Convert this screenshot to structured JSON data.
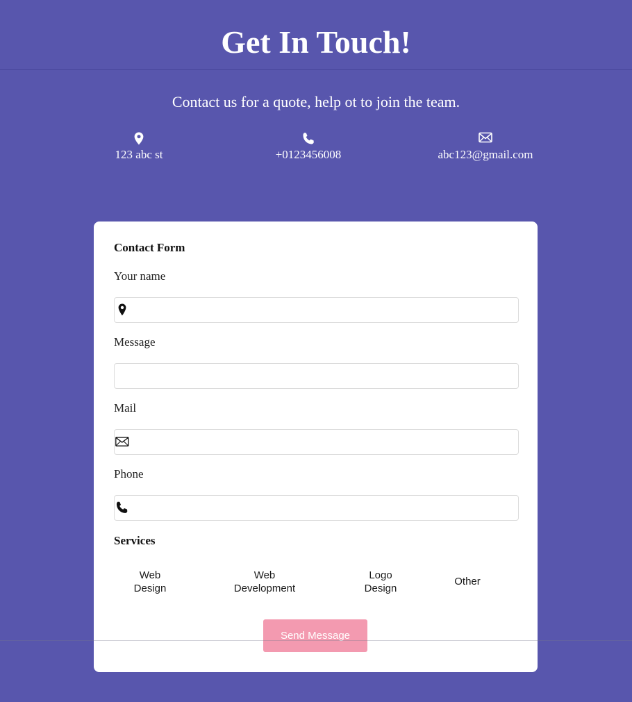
{
  "header": {
    "title": "Get In Touch!",
    "subtitle": "Contact us for a quote, help ot to join the team."
  },
  "contact_info": {
    "address": {
      "icon": "map-pin-icon",
      "text": "123 abc st"
    },
    "phone": {
      "icon": "phone-icon",
      "text": "+0123456008"
    },
    "email": {
      "icon": "envelope-icon",
      "text": "abc123@gmail.com"
    }
  },
  "form": {
    "heading": "Contact Form",
    "fields": {
      "name": {
        "label": "Your name",
        "value": "",
        "placeholder": "",
        "icon": "map-pin-icon"
      },
      "message": {
        "label": "Message",
        "value": "",
        "placeholder": ""
      },
      "mail": {
        "label": "Mail",
        "value": "",
        "placeholder": "",
        "icon": "envelope-icon"
      },
      "phone": {
        "label": "Phone",
        "value": "",
        "placeholder": "",
        "icon": "phone-icon"
      }
    },
    "services_heading": "Services",
    "services": [
      {
        "line1": "Web",
        "line2": "Design"
      },
      {
        "line1": "Web",
        "line2": "Development"
      },
      {
        "line1": "Logo",
        "line2": "Design"
      },
      {
        "line1": "Other",
        "line2": ""
      }
    ],
    "send_label": "Send Message"
  },
  "colors": {
    "background": "#5856ad",
    "card": "#ffffff",
    "send_button": "#f39ab0",
    "text_light": "#ffffff",
    "text_dark": "#1a1a1a"
  }
}
